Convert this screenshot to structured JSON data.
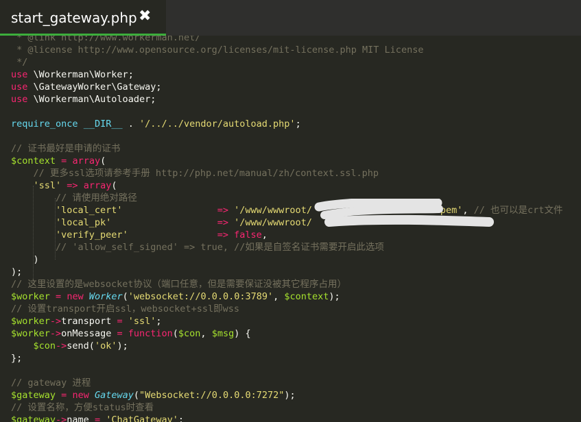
{
  "tab": {
    "title": "start_gateway.php",
    "close": "✖"
  },
  "lines": [
    [
      [
        "comment",
        " * @link http://www.workerman.net/"
      ]
    ],
    [
      [
        "comment",
        " * @license http://www.opensource.org/licenses/mit-license.php MIT License"
      ]
    ],
    [
      [
        "comment",
        " */"
      ]
    ],
    [
      [
        "kw",
        "use"
      ],
      [
        "plain",
        " \\Workerman\\Worker;"
      ]
    ],
    [
      [
        "kw",
        "use"
      ],
      [
        "plain",
        " \\GatewayWorker\\Gateway;"
      ]
    ],
    [
      [
        "kw",
        "use"
      ],
      [
        "plain",
        " \\Workerman\\Autoloader;"
      ]
    ],
    [],
    [
      [
        "func",
        "require_once"
      ],
      [
        "plain",
        " "
      ],
      [
        "func",
        "__DIR__"
      ],
      [
        "plain",
        " . "
      ],
      [
        "str",
        "'/../../vendor/autoload.php'"
      ],
      [
        "plain",
        ";"
      ]
    ],
    [],
    [
      [
        "comment",
        "// 证书最好是申请的证书"
      ]
    ],
    [
      [
        "var",
        "$context"
      ],
      [
        "plain",
        " "
      ],
      [
        "kw",
        "="
      ],
      [
        "plain",
        " "
      ],
      [
        "kw",
        "array"
      ],
      [
        "plain",
        "("
      ]
    ],
    [
      [
        "plain",
        "    "
      ],
      [
        "comment",
        "// 更多ssl选项请参考手册 http://php.net/manual/zh/context.ssl.php"
      ]
    ],
    [
      [
        "plain",
        "    "
      ],
      [
        "str",
        "'ssl'"
      ],
      [
        "plain",
        " "
      ],
      [
        "kw",
        "=>"
      ],
      [
        "plain",
        " "
      ],
      [
        "kw",
        "array"
      ],
      [
        "plain",
        "("
      ]
    ],
    [
      [
        "plain",
        "        "
      ],
      [
        "comment",
        "// 请使用绝对路径"
      ]
    ],
    [
      [
        "plain",
        "        "
      ],
      [
        "str",
        "'local_cert'"
      ],
      [
        "plain",
        "                 "
      ],
      [
        "kw",
        "=>"
      ],
      [
        "plain",
        " "
      ],
      [
        "str",
        "'/www/wwwroot/                      .pem'"
      ],
      [
        "plain",
        ", "
      ],
      [
        "comment",
        "// 也可以是crt文件"
      ]
    ],
    [
      [
        "plain",
        "        "
      ],
      [
        "str",
        "'local_pk'"
      ],
      [
        "plain",
        "                   "
      ],
      [
        "kw",
        "=>"
      ],
      [
        "plain",
        " "
      ],
      [
        "str",
        "'/www/wwwroot/"
      ]
    ],
    [
      [
        "plain",
        "        "
      ],
      [
        "str",
        "'verify_peer'"
      ],
      [
        "plain",
        "                "
      ],
      [
        "kw",
        "=>"
      ],
      [
        "plain",
        " "
      ],
      [
        "kw",
        "false"
      ],
      [
        "plain",
        ","
      ]
    ],
    [
      [
        "plain",
        "        "
      ],
      [
        "comment",
        "// 'allow_self_signed' => true, //如果是自签名证书需要开启此选项"
      ]
    ],
    [
      [
        "plain",
        "    )"
      ]
    ],
    [
      [
        "plain",
        ");"
      ]
    ],
    [
      [
        "comment",
        "// 这里设置的是websocket协议（端口任意，但是需要保证没被其它程序占用）"
      ]
    ],
    [
      [
        "var",
        "$worker"
      ],
      [
        "plain",
        " "
      ],
      [
        "kw",
        "="
      ],
      [
        "plain",
        " "
      ],
      [
        "kw",
        "new"
      ],
      [
        "plain",
        " "
      ],
      [
        "class",
        "Worker"
      ],
      [
        "plain",
        "("
      ],
      [
        "str",
        "'websocket://0.0.0.0:3789'"
      ],
      [
        "plain",
        ", "
      ],
      [
        "var",
        "$context"
      ],
      [
        "plain",
        ");"
      ]
    ],
    [
      [
        "comment",
        "// 设置transport开启ssl，websocket+ssl即wss"
      ]
    ],
    [
      [
        "var",
        "$worker"
      ],
      [
        "kw",
        "->"
      ],
      [
        "plain",
        "transport "
      ],
      [
        "kw",
        "="
      ],
      [
        "plain",
        " "
      ],
      [
        "str",
        "'ssl'"
      ],
      [
        "plain",
        ";"
      ]
    ],
    [
      [
        "var",
        "$worker"
      ],
      [
        "kw",
        "->"
      ],
      [
        "plain",
        "onMessage "
      ],
      [
        "kw",
        "="
      ],
      [
        "plain",
        " "
      ],
      [
        "kw",
        "function"
      ],
      [
        "plain",
        "("
      ],
      [
        "var",
        "$con"
      ],
      [
        "plain",
        ", "
      ],
      [
        "var",
        "$msg"
      ],
      [
        "plain",
        ") {"
      ]
    ],
    [
      [
        "plain",
        "    "
      ],
      [
        "var",
        "$con"
      ],
      [
        "kw",
        "->"
      ],
      [
        "plain",
        "send("
      ],
      [
        "str",
        "'ok'"
      ],
      [
        "plain",
        ");"
      ]
    ],
    [
      [
        "plain",
        "};"
      ]
    ],
    [],
    [
      [
        "comment",
        "// gateway 进程"
      ]
    ],
    [
      [
        "var",
        "$gateway"
      ],
      [
        "plain",
        " "
      ],
      [
        "kw",
        "="
      ],
      [
        "plain",
        " "
      ],
      [
        "kw",
        "new"
      ],
      [
        "plain",
        " "
      ],
      [
        "class",
        "Gateway"
      ],
      [
        "plain",
        "("
      ],
      [
        "str",
        "\"Websocket://0.0.0.0:7272\""
      ],
      [
        "plain",
        ");"
      ]
    ],
    [
      [
        "comment",
        "// 设置名称，方便status时查看"
      ]
    ],
    [
      [
        "var",
        "$gateway"
      ],
      [
        "kw",
        "->"
      ],
      [
        "plain",
        "name "
      ],
      [
        "kw",
        "="
      ],
      [
        "plain",
        " "
      ],
      [
        "str",
        "'ChatGateway'"
      ],
      [
        "plain",
        ";"
      ]
    ]
  ]
}
